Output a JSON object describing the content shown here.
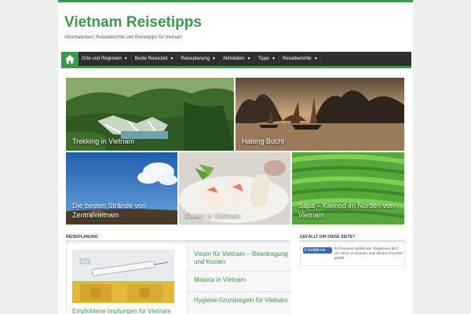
{
  "site": {
    "title": "Vietnam Reisetipps",
    "tagline": "Informationen, Reiseberichte und Reisetipps für Vietnam"
  },
  "nav": {
    "home_icon": "home-icon",
    "items": [
      {
        "label": "Orte und Regionen"
      },
      {
        "label": "Beste Reisezeit"
      },
      {
        "label": "Reiseplanung"
      },
      {
        "label": "Aktivitäten"
      },
      {
        "label": "Tipps"
      },
      {
        "label": "Reiseberichte"
      }
    ],
    "caret_icon": "caret-down-icon"
  },
  "featured": [
    {
      "label": "Trekking in Vietnam"
    },
    {
      "label": "Halong Bucht"
    },
    {
      "label": "Die besten Strände von Zentralvietnam"
    },
    {
      "label": "Essen in Vietnam"
    },
    {
      "label": "Sapa – Kleinod im Norden von Vietnam"
    }
  ],
  "reiseplanung": {
    "title": "REISEPLANUNG",
    "image_link": "Empfohlene Impfungen für Vietnam",
    "links": [
      "Visum für Vietnam – Beantragung und Kosten",
      "Malaria in Vietnam",
      "Hygiene-Grundregeln für Vietnam"
    ]
  },
  "facebook": {
    "title": "GEFÄLLT DIR DIESE SEITE?",
    "button": "Gefällt mir",
    "text": "82 Personen gefällt das. Registriere dich, um sehen zu können, was deinen Freunden gefällt."
  },
  "colors": {
    "accent": "#3a9a4a",
    "nav_bg": "#2e2e2e",
    "facebook": "#4267b2"
  }
}
